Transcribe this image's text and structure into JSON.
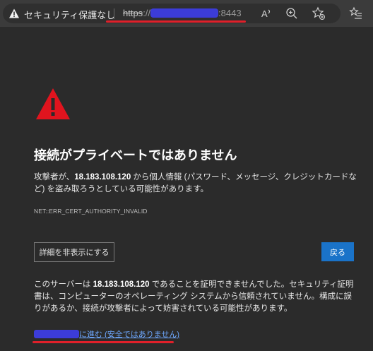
{
  "address_bar": {
    "security_label": "セキュリティ保護なし",
    "url_scheme": "https",
    "url_sep": "://",
    "url_suffix": ":8443"
  },
  "page": {
    "heading": "接続がプライベートではありません",
    "desc_before": "攻撃者が、",
    "desc_host": "18.183.108.120",
    "desc_after": " から個人情報 (パスワード、メッセージ、クレジットカードなど) を盗み取ろうとしている可能性があります。",
    "error_code": "NET::ERR_CERT_AUTHORITY_INVALID",
    "details_button": "詳細を非表示にする",
    "back_button": "戻る",
    "explain_before": "このサーバーは ",
    "explain_host": "18.183.108.120",
    "explain_after": " であることを証明できませんでした。セキュリティ証明書は、コンピューターのオペレーティング システムから信頼されていません。構成に誤りがあるか、接続が攻撃者によって妨害されている可能性があります。",
    "proceed_link": "に進む (安全ではありません)"
  },
  "colors": {
    "background": "#2b2b2b",
    "accent": "#1a73c9",
    "warning": "#e0141e",
    "link": "#6ea8ff"
  }
}
